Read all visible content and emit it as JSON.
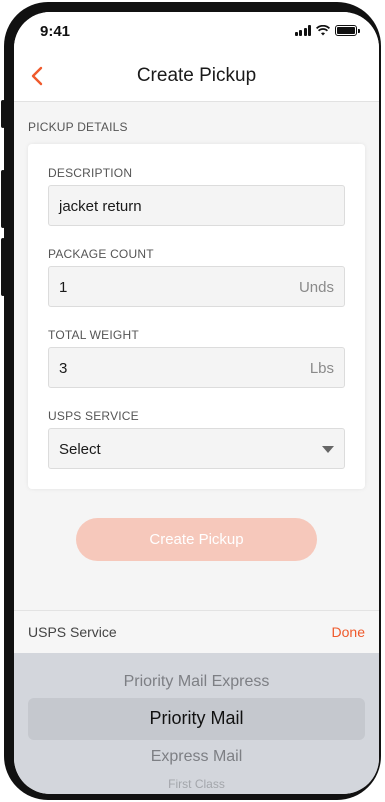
{
  "status_bar": {
    "time": "9:41"
  },
  "nav": {
    "title": "Create Pickup"
  },
  "section": {
    "label": "PICKUP DETAILS"
  },
  "form": {
    "description": {
      "label": "DESCRIPTION",
      "value": "jacket return"
    },
    "package_count": {
      "label": "PACKAGE COUNT",
      "value": "1",
      "unit": "Unds"
    },
    "total_weight": {
      "label": "TOTAL WEIGHT",
      "value": "3",
      "unit": "Lbs"
    },
    "usps_service": {
      "label": "USPS SERVICE",
      "value": "Select"
    }
  },
  "create_button": {
    "label": "Create Pickup"
  },
  "picker": {
    "title": "USPS Service",
    "done_label": "Done",
    "options": [
      "Priority Mail Express",
      "Priority Mail",
      "Express Mail",
      "First Class"
    ],
    "selected": "Priority Mail"
  },
  "colors": {
    "accent": "#ef5a2c",
    "button_disabled": "#f6c8bb",
    "picker_bg": "#d3d6dc"
  }
}
